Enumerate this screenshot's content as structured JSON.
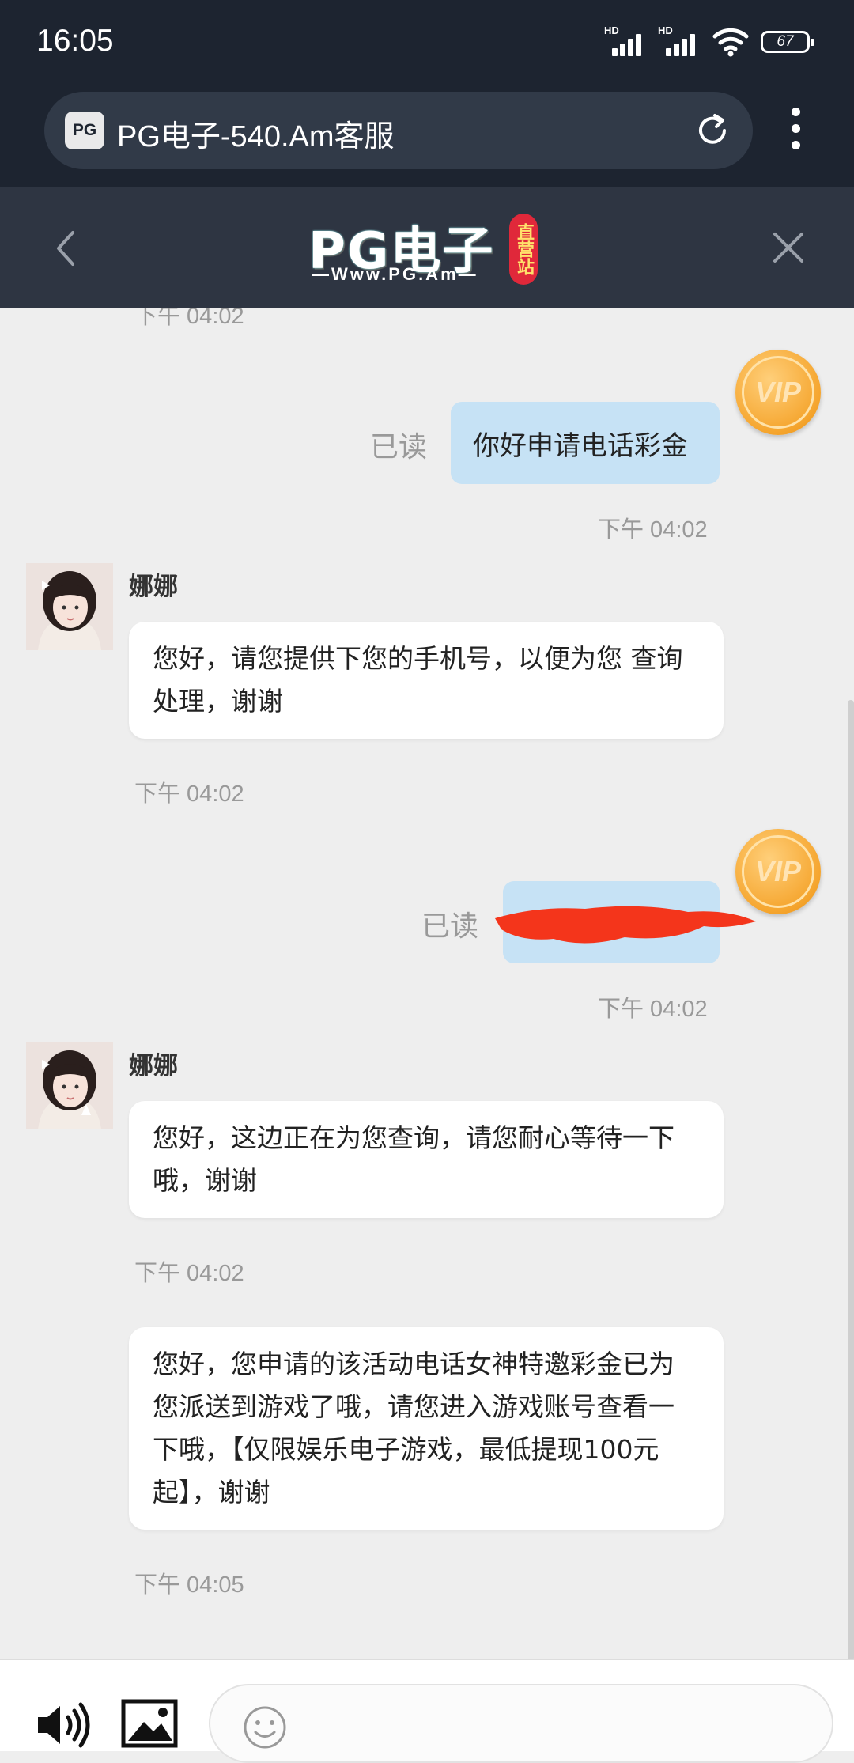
{
  "status_bar": {
    "time": "16:05",
    "signal1_label": "HD",
    "signal2_label": "HD",
    "battery": "67"
  },
  "browser": {
    "favicon_text": "PG",
    "title": "PG电子-540.Am客服"
  },
  "header": {
    "logo_main": "PG电子",
    "logo_sub": "—Www.PG.Am—",
    "logo_badge": "直营站"
  },
  "colors": {
    "top_bar": "#1d2430",
    "header": "#2e3542",
    "outgoing_bubble": "#c6e2f5",
    "vip_gold": "#f5a52e",
    "redaction": "#f4351b"
  },
  "chat": {
    "partial_timestamp": "下午 04:02",
    "messages": [
      {
        "direction": "out",
        "text": "你好申请电话彩金",
        "read": "已读",
        "time": "下午 04:02",
        "badge": "VIP"
      },
      {
        "direction": "in",
        "sender": "娜娜",
        "text": "您好，请您提供下您的手机号，以便为您 查询处理，谢谢",
        "time": "下午 04:02"
      },
      {
        "direction": "out",
        "text": "",
        "redacted": true,
        "read": "已读",
        "time": "下午 04:02",
        "badge": "VIP"
      },
      {
        "direction": "in",
        "sender": "娜娜",
        "text": "您好，这边正在为您查询，请您耐心等待一下哦，谢谢",
        "time": "下午 04:02"
      },
      {
        "direction": "in",
        "sender": "",
        "text": "您好，您申请的该活动电话女神特邀彩金已为您派送到游戏了哦，请您进入游戏账号查看一下哦，【仅限娱乐电子游戏，最低提现100元起】，谢谢",
        "time": "下午 04:05"
      }
    ]
  },
  "composer": {
    "placeholder": ""
  }
}
